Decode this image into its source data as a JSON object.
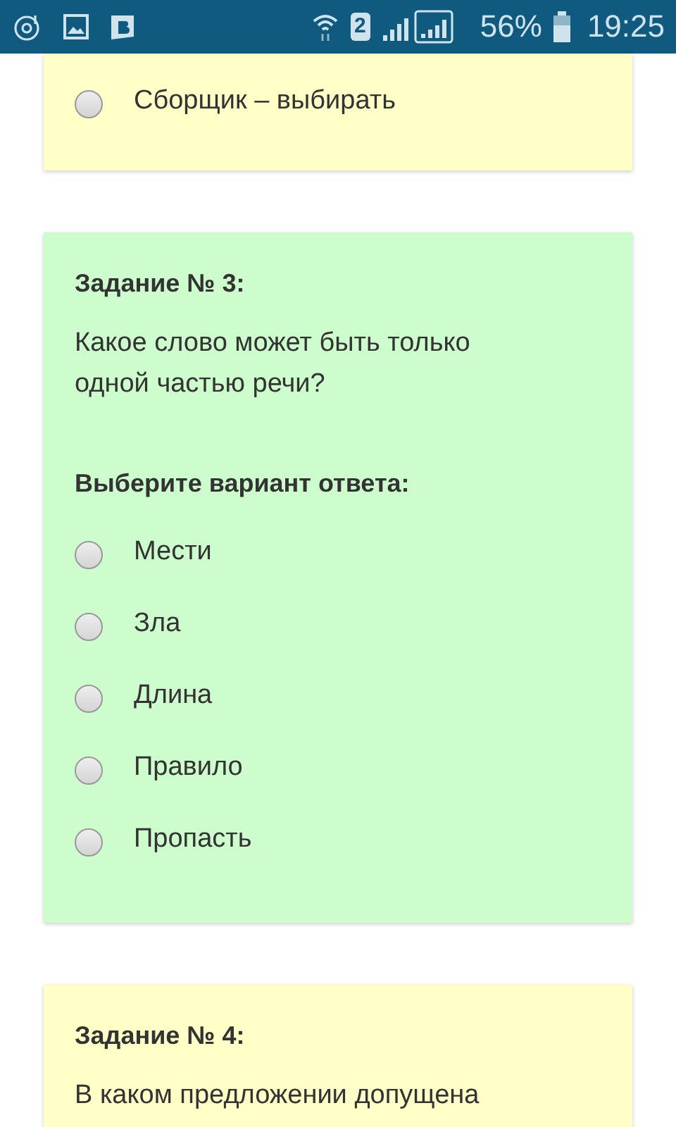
{
  "status_bar": {
    "sim": "2",
    "battery": "56%",
    "time": "19:25"
  },
  "cards": [
    {
      "color": "#ffffc8",
      "options": [
        {
          "label": "Сборщик – выбирать",
          "selected": false
        }
      ]
    },
    {
      "color": "#cdfdcd",
      "title": "Задание № 3:",
      "question": "Какое слово может быть только одной частью речи?",
      "prompt": "Выберите вариант ответа:",
      "options": [
        {
          "label": "Мести",
          "selected": false
        },
        {
          "label": "Зла",
          "selected": false
        },
        {
          "label": "Длина",
          "selected": false
        },
        {
          "label": "Правило",
          "selected": false
        },
        {
          "label": "Пропасть",
          "selected": false
        }
      ]
    },
    {
      "color": "#ffffc8",
      "title": "Задание № 4:",
      "question": "В каком предложении допущена"
    }
  ]
}
